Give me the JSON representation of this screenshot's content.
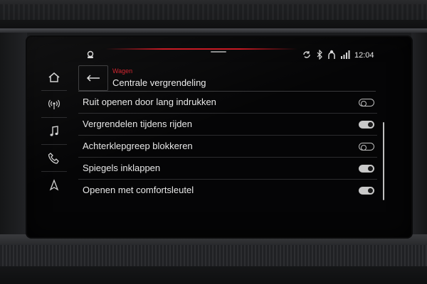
{
  "status_bar": {
    "time": "12:04",
    "icons": [
      "car-settings-icon",
      "sync-icon",
      "bluetooth-icon",
      "person-icon",
      "signal-icon"
    ]
  },
  "nav": {
    "items": [
      {
        "name": "home",
        "icon": "home-icon"
      },
      {
        "name": "radio",
        "icon": "radio-signal-icon"
      },
      {
        "name": "media",
        "icon": "music-note-icon"
      },
      {
        "name": "phone",
        "icon": "phone-icon"
      },
      {
        "name": "navigation",
        "icon": "navigation-arrow-icon"
      }
    ]
  },
  "header": {
    "breadcrumb": "Wagen",
    "title": "Centrale vergrendeling",
    "back_icon": "back-arrow-icon"
  },
  "settings": [
    {
      "label": "Ruit openen door lang indrukken",
      "enabled": false
    },
    {
      "label": "Vergrendelen tijdens rijden",
      "enabled": true
    },
    {
      "label": "Achterklepgreep blokkeren",
      "enabled": false
    },
    {
      "label": "Spiegels inklappen",
      "enabled": true
    },
    {
      "label": "Openen met comfortsleutel",
      "enabled": true
    }
  ],
  "colors": {
    "accent_red": "#d0202a",
    "text": "#e8e8e8",
    "background": "#050506"
  }
}
